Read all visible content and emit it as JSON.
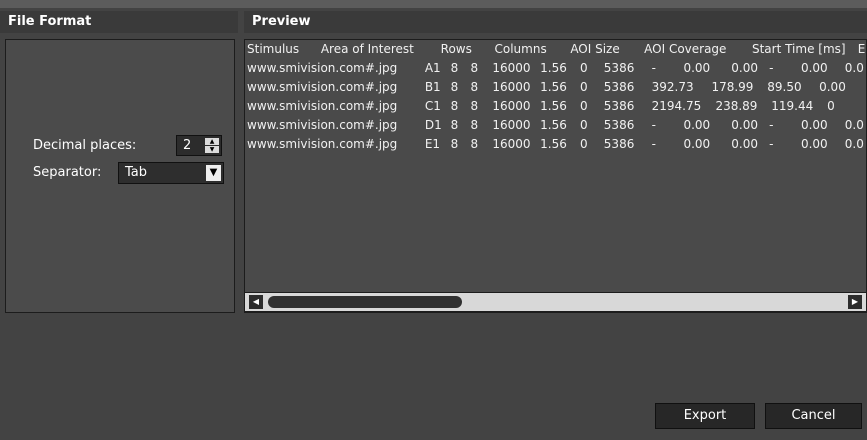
{
  "panels": {
    "file_format_title": "File Format",
    "preview_title": "Preview"
  },
  "format": {
    "decimal_label": "Decimal places:",
    "decimal_value": "2",
    "separator_label": "Separator:",
    "separator_value": "Tab"
  },
  "preview": {
    "header": [
      "Stimulus",
      "Area of Interest",
      "Rows",
      "Columns",
      "AOI Size",
      "AOI Coverage",
      "Start Time [ms]",
      "End"
    ],
    "rows": [
      [
        "www.smivision.com#.jpg",
        "A1",
        "8",
        "8",
        "16000",
        "1.56",
        "0",
        "5386",
        "-",
        "0.00",
        "0.00",
        "-",
        "0.00",
        "0.0"
      ],
      [
        "www.smivision.com#.jpg",
        "B1",
        "8",
        "8",
        "16000",
        "1.56",
        "0",
        "5386",
        "392.73",
        "178.99",
        "89.50",
        "0.00"
      ],
      [
        "www.smivision.com#.jpg",
        "C1",
        "8",
        "8",
        "16000",
        "1.56",
        "0",
        "5386",
        "2194.75",
        "238.89",
        "119.44",
        "0"
      ],
      [
        "www.smivision.com#.jpg",
        "D1",
        "8",
        "8",
        "16000",
        "1.56",
        "0",
        "5386",
        "-",
        "0.00",
        "0.00",
        "-",
        "0.00",
        "0.0"
      ],
      [
        "www.smivision.com#.jpg",
        "E1",
        "8",
        "8",
        "16000",
        "1.56",
        "0",
        "5386",
        "-",
        "0.00",
        "0.00",
        "-",
        "0.00",
        "0.0"
      ]
    ]
  },
  "actions": {
    "export_label": "Export",
    "cancel_label": "Cancel"
  },
  "icons": {
    "stepper_up": "▲",
    "stepper_down": "▼",
    "dropdown": "▼",
    "scroll_left": "◀",
    "scroll_right": "▶"
  }
}
